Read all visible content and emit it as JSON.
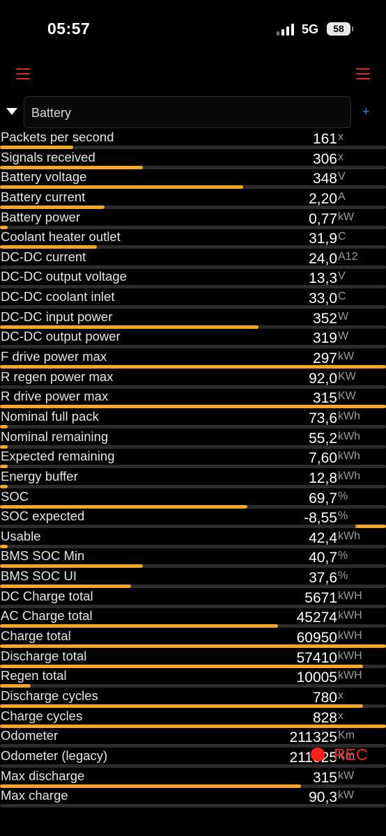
{
  "status": {
    "time": "05:57",
    "network": "5G",
    "battery": "58"
  },
  "header": {
    "left_icon": "menu-icon",
    "right_icon": "menu-icon",
    "icon_color": "#e0271c"
  },
  "selector": {
    "value": "Battery",
    "add_label": "+"
  },
  "bar_color": "#f5a623",
  "track_color": "#2c2c2e",
  "metrics": [
    {
      "label": "Packets per second",
      "value": "161",
      "unit": "x",
      "level": 0.19
    },
    {
      "label": "Signals received",
      "value": "306",
      "unit": "x",
      "level": 0.37
    },
    {
      "label": "Battery voltage",
      "value": "348",
      "unit": "V",
      "level": 0.63
    },
    {
      "label": "Battery current",
      "value": "2,20",
      "unit": "A",
      "level": 0.27
    },
    {
      "label": "Battery power",
      "value": "0,77",
      "unit": "kW",
      "level": 0.02
    },
    {
      "label": "Coolant heater outlet",
      "value": "31,9",
      "unit": "C",
      "level": 0.25
    },
    {
      "label": "DC-DC current",
      "value": "24,0",
      "unit": "A12",
      "level": 0
    },
    {
      "label": "DC-DC output voltage",
      "value": "13,3",
      "unit": "V",
      "level": 0
    },
    {
      "label": "DC-DC coolant inlet",
      "value": "33,0",
      "unit": "C",
      "level": 0
    },
    {
      "label": "DC-DC input power",
      "value": "352",
      "unit": "W",
      "level": 0.67
    },
    {
      "label": "DC-DC output power",
      "value": "319",
      "unit": "W",
      "level": 0
    },
    {
      "label": "F drive power max",
      "value": "297",
      "unit": "kW",
      "level": 1.0
    },
    {
      "label": "R regen power max",
      "value": "92,0",
      "unit": "KW",
      "level": 0
    },
    {
      "label": "R drive power max",
      "value": "315",
      "unit": "KW",
      "level": 1.0
    },
    {
      "label": "Nominal full pack",
      "value": "73,6",
      "unit": "kWh",
      "level": 0.02
    },
    {
      "label": "Nominal remaining",
      "value": "55,2",
      "unit": "kWh",
      "level": 0.02
    },
    {
      "label": "Expected remaining",
      "value": "7,60",
      "unit": "kWh",
      "level": 0.02
    },
    {
      "label": "Energy buffer",
      "value": "12,8",
      "unit": "kWh",
      "level": 0.02
    },
    {
      "label": "SOC",
      "value": "69,7",
      "unit": "%",
      "level": 0.64
    },
    {
      "label": "SOC expected",
      "value": "-8,55",
      "unit": "%",
      "level": -0.08
    },
    {
      "label": "Usable",
      "value": "42,4",
      "unit": "kWh",
      "level": 0.02
    },
    {
      "label": "BMS SOC Min",
      "value": "40,7",
      "unit": "%",
      "level": 0.37
    },
    {
      "label": "BMS SOC UI",
      "value": "37,6",
      "unit": "%",
      "level": 0.34
    },
    {
      "label": "DC Charge total",
      "value": "5671",
      "unit": "kWH",
      "level": 0
    },
    {
      "label": "AC Charge total",
      "value": "45274",
      "unit": "kWH",
      "level": 0.72
    },
    {
      "label": "Charge total",
      "value": "60950",
      "unit": "kWH",
      "level": 1.0
    },
    {
      "label": "Discharge total",
      "value": "57410",
      "unit": "kWH",
      "level": 0.94
    },
    {
      "label": "Regen total",
      "value": "10005",
      "unit": "kWH",
      "level": 0.08
    },
    {
      "label": "Discharge cycles",
      "value": "780",
      "unit": "x",
      "level": 0.94
    },
    {
      "label": "Charge cycles",
      "value": "828",
      "unit": "x",
      "level": 1.0
    },
    {
      "label": "Odometer",
      "value": "211325",
      "unit": "Km",
      "level": 0
    },
    {
      "label": "Odometer (legacy)",
      "value": "211325",
      "unit": "Km",
      "level": 0
    },
    {
      "label": "Max discharge",
      "value": "315",
      "unit": "kW",
      "level": 0.78
    },
    {
      "label": "Max charge",
      "value": "90,3",
      "unit": "kW",
      "level": 0
    }
  ],
  "recording": {
    "label": "REC",
    "color": "#ff2218"
  }
}
